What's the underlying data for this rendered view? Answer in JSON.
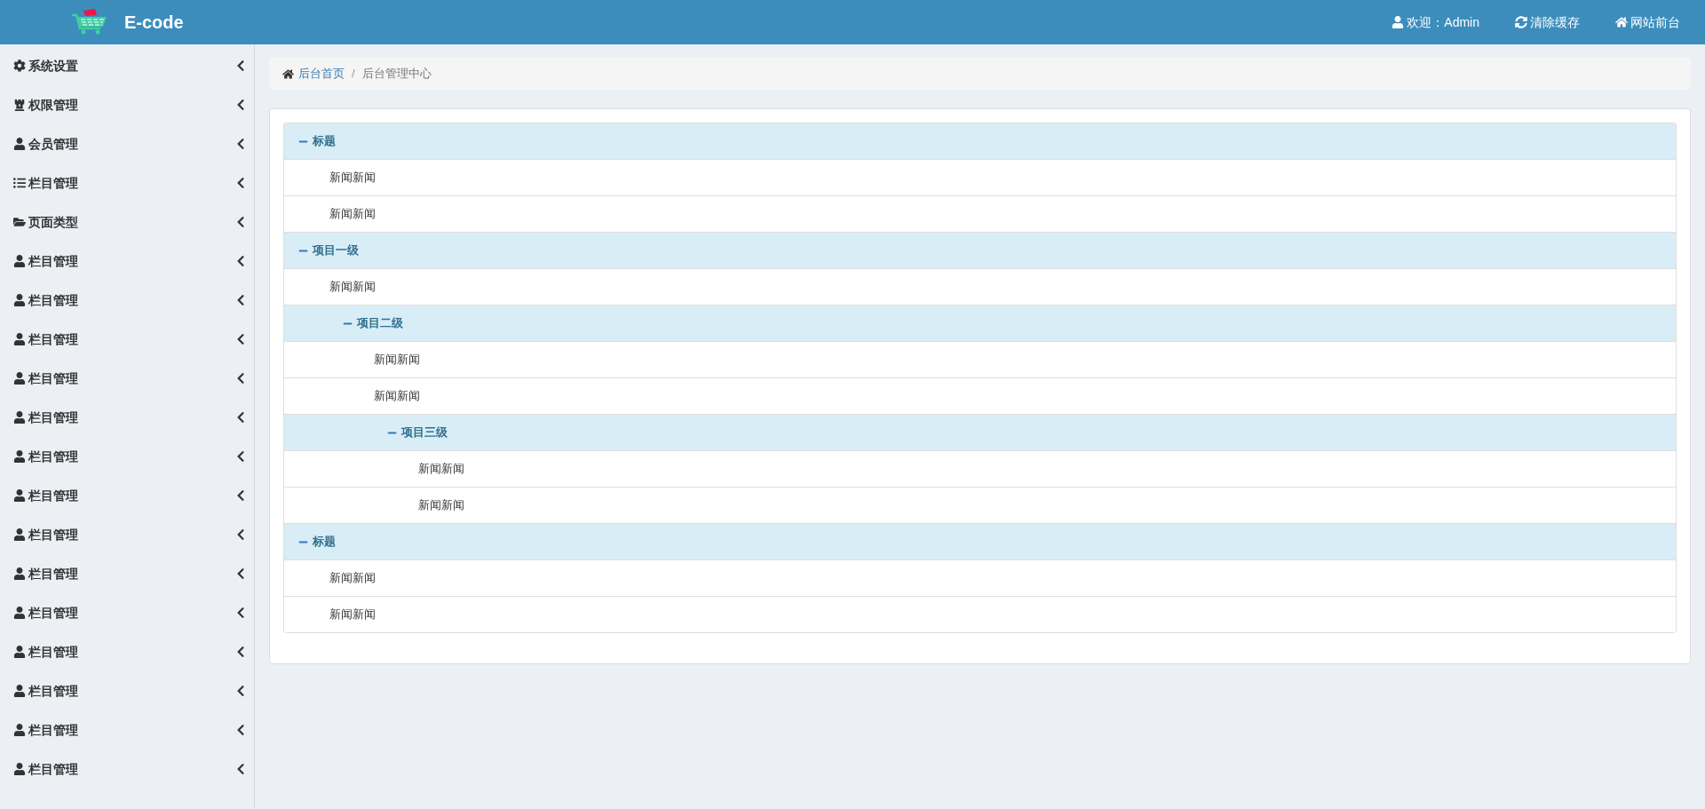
{
  "header": {
    "logo_text": "E-code",
    "nav": [
      {
        "kind": "user",
        "label": "欢迎：Admin"
      },
      {
        "kind": "refresh",
        "label": "清除缓存"
      },
      {
        "kind": "home",
        "label": "网站前台"
      }
    ]
  },
  "sidebar": {
    "items": [
      {
        "kind": "gear",
        "label": "系统设置"
      },
      {
        "kind": "rook",
        "label": "权限管理"
      },
      {
        "kind": "user",
        "label": "会员管理"
      },
      {
        "kind": "list",
        "label": "栏目管理"
      },
      {
        "kind": "folder",
        "label": "页面类型"
      },
      {
        "kind": "user",
        "label": "栏目管理"
      },
      {
        "kind": "user",
        "label": "栏目管理"
      },
      {
        "kind": "user",
        "label": "栏目管理"
      },
      {
        "kind": "user",
        "label": "栏目管理"
      },
      {
        "kind": "user",
        "label": "栏目管理"
      },
      {
        "kind": "user",
        "label": "栏目管理"
      },
      {
        "kind": "user",
        "label": "栏目管理"
      },
      {
        "kind": "user",
        "label": "栏目管理"
      },
      {
        "kind": "user",
        "label": "栏目管理"
      },
      {
        "kind": "user",
        "label": "栏目管理"
      },
      {
        "kind": "user",
        "label": "栏目管理"
      },
      {
        "kind": "user",
        "label": "栏目管理"
      },
      {
        "kind": "user",
        "label": "栏目管理"
      },
      {
        "kind": "user",
        "label": "栏目管理"
      }
    ]
  },
  "breadcrumb": {
    "separator": "/",
    "items": [
      {
        "kind": "link",
        "label": "后台首页"
      },
      {
        "kind": "current",
        "label": "后台管理中心"
      }
    ]
  },
  "tree": [
    {
      "kind": "group",
      "label": "标题",
      "expanded": true,
      "children": [
        {
          "kind": "leaf",
          "label": "新闻新闻"
        },
        {
          "kind": "leaf",
          "label": "新闻新闻"
        }
      ]
    },
    {
      "kind": "group",
      "label": "项目一级",
      "expanded": true,
      "children": [
        {
          "kind": "leaf",
          "label": "新闻新闻"
        },
        {
          "kind": "group",
          "label": "项目二级",
          "expanded": true,
          "children": [
            {
              "kind": "leaf",
              "label": "新闻新闻"
            },
            {
              "kind": "leaf",
              "label": "新闻新闻"
            },
            {
              "kind": "group",
              "label": "项目三级",
              "expanded": true,
              "children": [
                {
                  "kind": "leaf",
                  "label": "新闻新闻"
                },
                {
                  "kind": "leaf",
                  "label": "新闻新闻"
                }
              ]
            }
          ]
        }
      ]
    },
    {
      "kind": "group",
      "label": "标题",
      "expanded": true,
      "children": [
        {
          "kind": "leaf",
          "label": "新闻新闻"
        },
        {
          "kind": "leaf",
          "label": "新闻新闻"
        }
      ]
    }
  ]
}
